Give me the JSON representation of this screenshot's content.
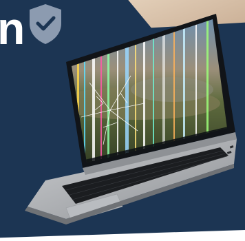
{
  "heading_fragment": "n",
  "icons": {
    "shield": "shield-check-icon"
  },
  "colors": {
    "background": "#1c3553",
    "shield": "#8c9bb0",
    "screen_frame": "#111418",
    "laptop_body": "#a9acb0"
  }
}
